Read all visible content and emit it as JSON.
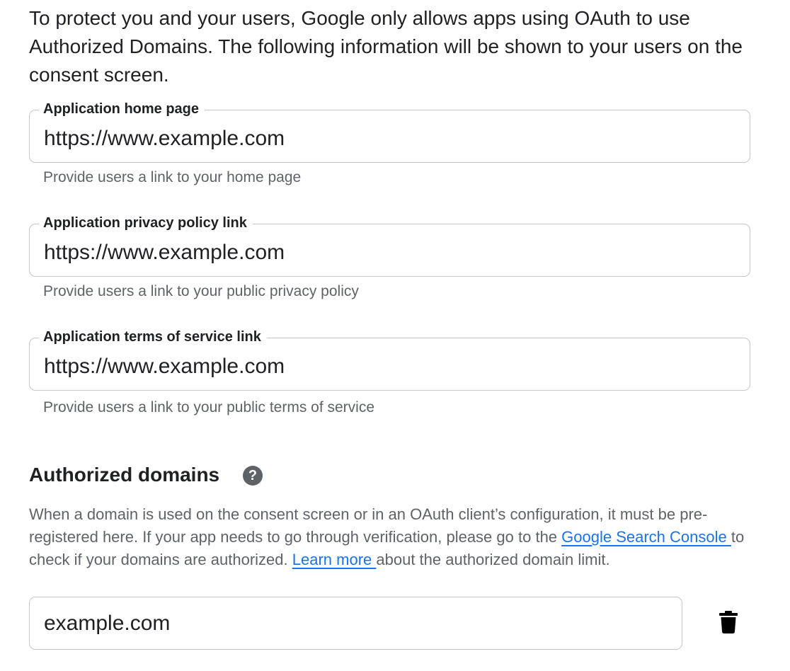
{
  "intro": {
    "text": "To protect you and your users, Google only allows apps using OAuth to use Authorized Domains. The following information will be shown to your users on the consent screen."
  },
  "fields": [
    {
      "label": "Application home page",
      "value": "https://www.example.com",
      "hint": "Provide users a link to your home page"
    },
    {
      "label": "Application privacy policy link",
      "value": "https://www.example.com",
      "hint": "Provide users a link to your public privacy policy"
    },
    {
      "label": "Application terms of service link",
      "value": "https://www.example.com",
      "hint": "Provide users a link to your public terms of service"
    }
  ],
  "authorized_domains": {
    "title": "Authorized domains",
    "help_icon": "help-circle-icon",
    "help_glyph": "?",
    "description_part1": "When a domain is used on the consent screen or in an OAuth client’s configuration, it must be pre-registered here. If your app needs to go through verification, please go to the ",
    "search_console_link": "Google Search Console ",
    "description_part2": "to check if your domains are authorized. ",
    "learn_more_link": "Learn more ",
    "description_part3": "about the authorized domain limit.",
    "domains": [
      {
        "value": "example.com",
        "delete_icon": "trash-icon"
      }
    ]
  },
  "colors": {
    "text_primary": "#202124",
    "text_secondary": "#5f6368",
    "link": "#1a73e8",
    "field_border": "#c6c6c6"
  }
}
